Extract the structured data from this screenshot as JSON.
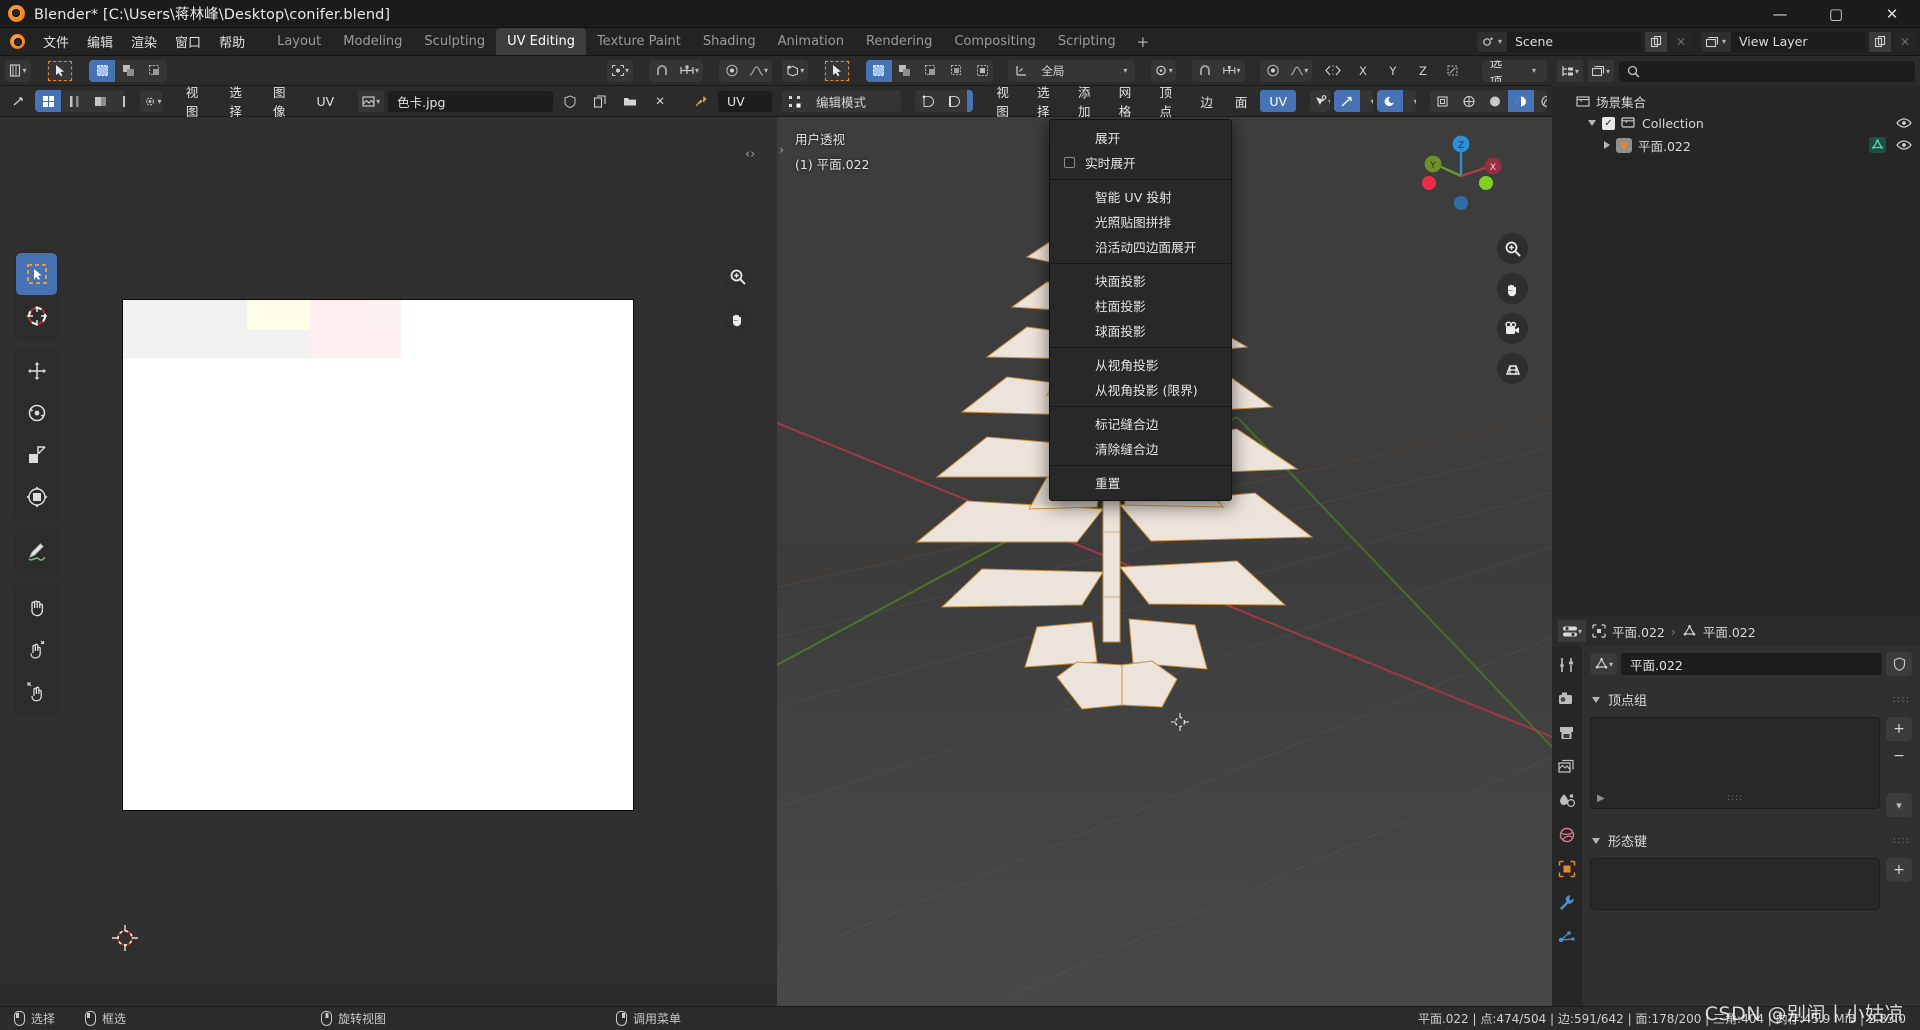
{
  "window": {
    "title": "Blender* [C:\\Users\\蒋林峰\\Desktop\\conifer.blend]",
    "minimize": "—",
    "maximize": "▢",
    "close": "✕"
  },
  "topbar": {
    "menus": [
      "文件",
      "编辑",
      "渲染",
      "窗口",
      "帮助"
    ],
    "workspaces": [
      {
        "label": "Layout",
        "active": false
      },
      {
        "label": "Modeling",
        "active": false
      },
      {
        "label": "Sculpting",
        "active": false
      },
      {
        "label": "UV Editing",
        "active": true
      },
      {
        "label": "Texture Paint",
        "active": false
      },
      {
        "label": "Shading",
        "active": false
      },
      {
        "label": "Animation",
        "active": false
      },
      {
        "label": "Rendering",
        "active": false
      },
      {
        "label": "Compositing",
        "active": false
      },
      {
        "label": "Scripting",
        "active": false
      }
    ],
    "add_workspace": "+",
    "scene_name": "Scene",
    "view_layer_name": "View Layer"
  },
  "uv_editor": {
    "tool_header": {
      "snap_label": "",
      "proportional": ""
    },
    "menus": [
      "视图",
      "选择",
      "图像",
      "UV"
    ],
    "image_name": "色卡.jpg",
    "uv_suffix": "UV",
    "tools": [
      {
        "name": "tweak-tool",
        "active": false
      },
      {
        "name": "select-box-tool",
        "active": true
      },
      {
        "name": "cursor-tool",
        "active": false
      },
      {
        "name": "move-tool",
        "active": false
      },
      {
        "name": "rotate-tool",
        "active": false
      },
      {
        "name": "scale-tool",
        "active": false
      },
      {
        "name": "transform-tool",
        "active": false
      },
      {
        "name": "annotate-tool",
        "active": false
      },
      {
        "name": "grab-tool",
        "active": false
      },
      {
        "name": "relax-tool",
        "active": false
      },
      {
        "name": "pinch-tool",
        "active": false
      }
    ]
  },
  "viewport": {
    "mode": "编辑模式",
    "menus": [
      "视图",
      "选择",
      "添加",
      "网格",
      "顶点",
      "边",
      "面"
    ],
    "uv_menu_label": "UV",
    "transform_orientation": "全局",
    "options_label": "选项",
    "axis_buttons": [
      "X",
      "Y",
      "Z"
    ],
    "overlay_view": "用户透视",
    "overlay_object": "(1) 平面.022",
    "gizmo_axes": [
      "X",
      "Y",
      "Z"
    ]
  },
  "uv_menu": {
    "items": [
      {
        "label": "展开",
        "checkbox": false,
        "separator_after": false
      },
      {
        "label": "实时展开",
        "checkbox": true,
        "separator_after": true
      },
      {
        "label": "智能 UV 投射",
        "checkbox": false,
        "separator_after": false
      },
      {
        "label": "光照贴图拼排",
        "checkbox": false,
        "separator_after": false
      },
      {
        "label": "沿活动四边面展开",
        "checkbox": false,
        "separator_after": true
      },
      {
        "label": "块面投影",
        "checkbox": false,
        "separator_after": false
      },
      {
        "label": "柱面投影",
        "checkbox": false,
        "separator_after": false
      },
      {
        "label": "球面投影",
        "checkbox": false,
        "separator_after": true
      },
      {
        "label": "从视角投影",
        "checkbox": false,
        "separator_after": false
      },
      {
        "label": "从视角投影 (限界)",
        "checkbox": false,
        "separator_after": true
      },
      {
        "label": "标记缝合边",
        "checkbox": false,
        "separator_after": false
      },
      {
        "label": "清除缝合边",
        "checkbox": false,
        "separator_after": true
      },
      {
        "label": "重置",
        "checkbox": false,
        "separator_after": false
      }
    ]
  },
  "outliner": {
    "view_layer": "View Layer",
    "search_placeholder": "",
    "rows": [
      {
        "label": "场景集合",
        "depth": 0,
        "type": "scene-collection"
      },
      {
        "label": "Collection",
        "depth": 1,
        "type": "collection"
      },
      {
        "label": "平面.022",
        "depth": 2,
        "type": "mesh-object"
      }
    ]
  },
  "properties": {
    "breadcrumb_object": "平面.022",
    "breadcrumb_data": "平面.022",
    "data_name": "平面.022",
    "panels": [
      {
        "title": "顶点组",
        "expanded": true
      },
      {
        "title": "形态键",
        "expanded": true
      }
    ],
    "add_button": "+",
    "remove_button": "−",
    "tabs": [
      "tool-tab",
      "render-tab",
      "output-tab",
      "view-layer-tab",
      "scene-tab",
      "world-tab",
      "object-tab",
      "modifier-tab",
      "particles-tab"
    ]
  },
  "statusbar": {
    "hints": [
      {
        "mouse": "left",
        "label": "选择"
      },
      {
        "mouse": "left-drag",
        "label": "框选"
      },
      {
        "mouse": "middle",
        "label": "旋转视图"
      },
      {
        "mouse": "right",
        "label": "调用菜单"
      }
    ],
    "stats": "平面.022 | 点:474/504 | 边:591/642 | 面:178/200 | 三角:404 | 内存:45.9 MiB | 2.83.0",
    "watermark": "CSDN @别闹丨小姑凉"
  },
  "colors": {
    "accent_blue": "#4772b3",
    "orange": "#e8862c",
    "axis_x": "#b3384a",
    "axis_y": "#5e9e27",
    "axis_z": "#2e8fd6"
  }
}
